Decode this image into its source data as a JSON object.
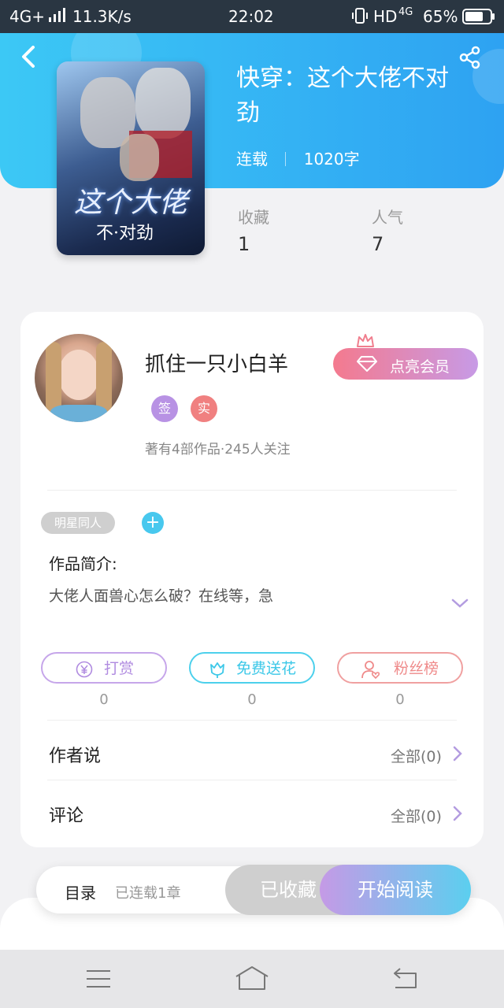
{
  "status_bar": {
    "network": "4G+",
    "speed": "11.3K/s",
    "time": "22:02",
    "hd": "HD",
    "net2": "4G",
    "battery": "65%"
  },
  "book": {
    "cover_title": "这个大佬",
    "cover_subtitle": "不·对劲",
    "title": "快穿：这个大佬不对劲",
    "status": "连载",
    "word_count": "1020字"
  },
  "stats": {
    "collect_label": "收藏",
    "collect_value": "1",
    "popularity_label": "人气",
    "popularity_value": "7"
  },
  "author": {
    "name": "抓住一只小白羊",
    "badge_sign": "签",
    "badge_real": "实",
    "info": "著有4部作品·245人关注",
    "vip_label": "点亮会员"
  },
  "tags": {
    "tag1": "明星同人",
    "add": "+"
  },
  "intro": {
    "heading": "作品简介:",
    "text": "大佬人面兽心怎么破？在线等，急"
  },
  "actions": [
    {
      "label": "打赏",
      "count": "0",
      "icon": "yen-icon",
      "color": "#b08be0"
    },
    {
      "label": "免费送花",
      "count": "0",
      "icon": "flower-icon",
      "color": "#3cc8e8"
    },
    {
      "label": "粉丝榜",
      "count": "0",
      "icon": "fans-icon",
      "color": "#ef8a8a"
    }
  ],
  "author_says": {
    "title": "作者说",
    "more": "全部(0)"
  },
  "comments": {
    "title": "评论",
    "more": "全部(0)"
  },
  "bottom_bar": {
    "toc": "目录",
    "chapters": "已连载1章",
    "collected": "已收藏",
    "read": "开始阅读"
  },
  "colors": {
    "header": "#3cc8f5",
    "vip_start": "#f47a8e",
    "vip_end": "#c79ae6",
    "read_start": "#c59ae6",
    "read_end": "#5bcfef"
  }
}
